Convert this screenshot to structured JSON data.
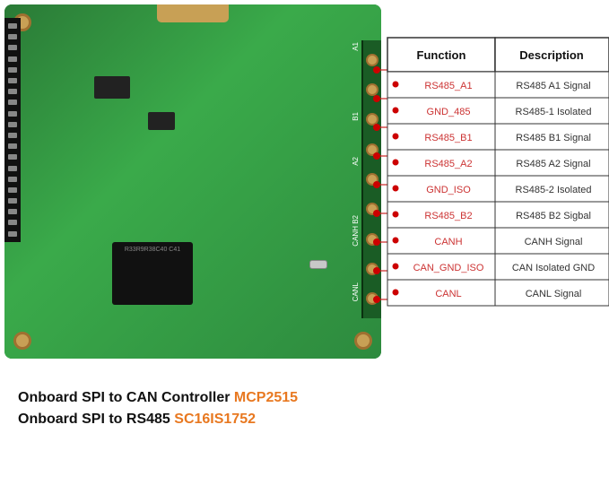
{
  "header": {
    "table_title_function": "Function",
    "table_title_description": "Description"
  },
  "table": {
    "rows": [
      {
        "function": "RS485_A1",
        "description": "RS485 A1 Signal"
      },
      {
        "function": "GND_485",
        "description": "RS485-1 Isolated"
      },
      {
        "function": "RS485_B1",
        "description": "RS485 B1 Signal"
      },
      {
        "function": "RS485_A2",
        "description": "RS485 A2 Signal"
      },
      {
        "function": "GND_ISO",
        "description": "RS485-2 Isolated"
      },
      {
        "function": "RS485_B2",
        "description": "RS485 B2 Sigbal"
      },
      {
        "function": "CANH",
        "description": "CANH Signal"
      },
      {
        "function": "CAN_GND_ISO",
        "description": "CAN Isolated GND"
      },
      {
        "function": "CANL",
        "description": "CANL Signal"
      }
    ]
  },
  "footer": {
    "line1_prefix": "Onboard SPI to CAN Controller ",
    "line1_highlight": "MCP2515",
    "line2_prefix": "Onboard SPI to RS485 ",
    "line2_highlight": "SC16IS1752"
  },
  "pcb_labels": {
    "a1": "A1",
    "b1": "B1",
    "a2": "A2",
    "b2": "B2",
    "canh": "CANH B2",
    "canl": "CANL"
  }
}
